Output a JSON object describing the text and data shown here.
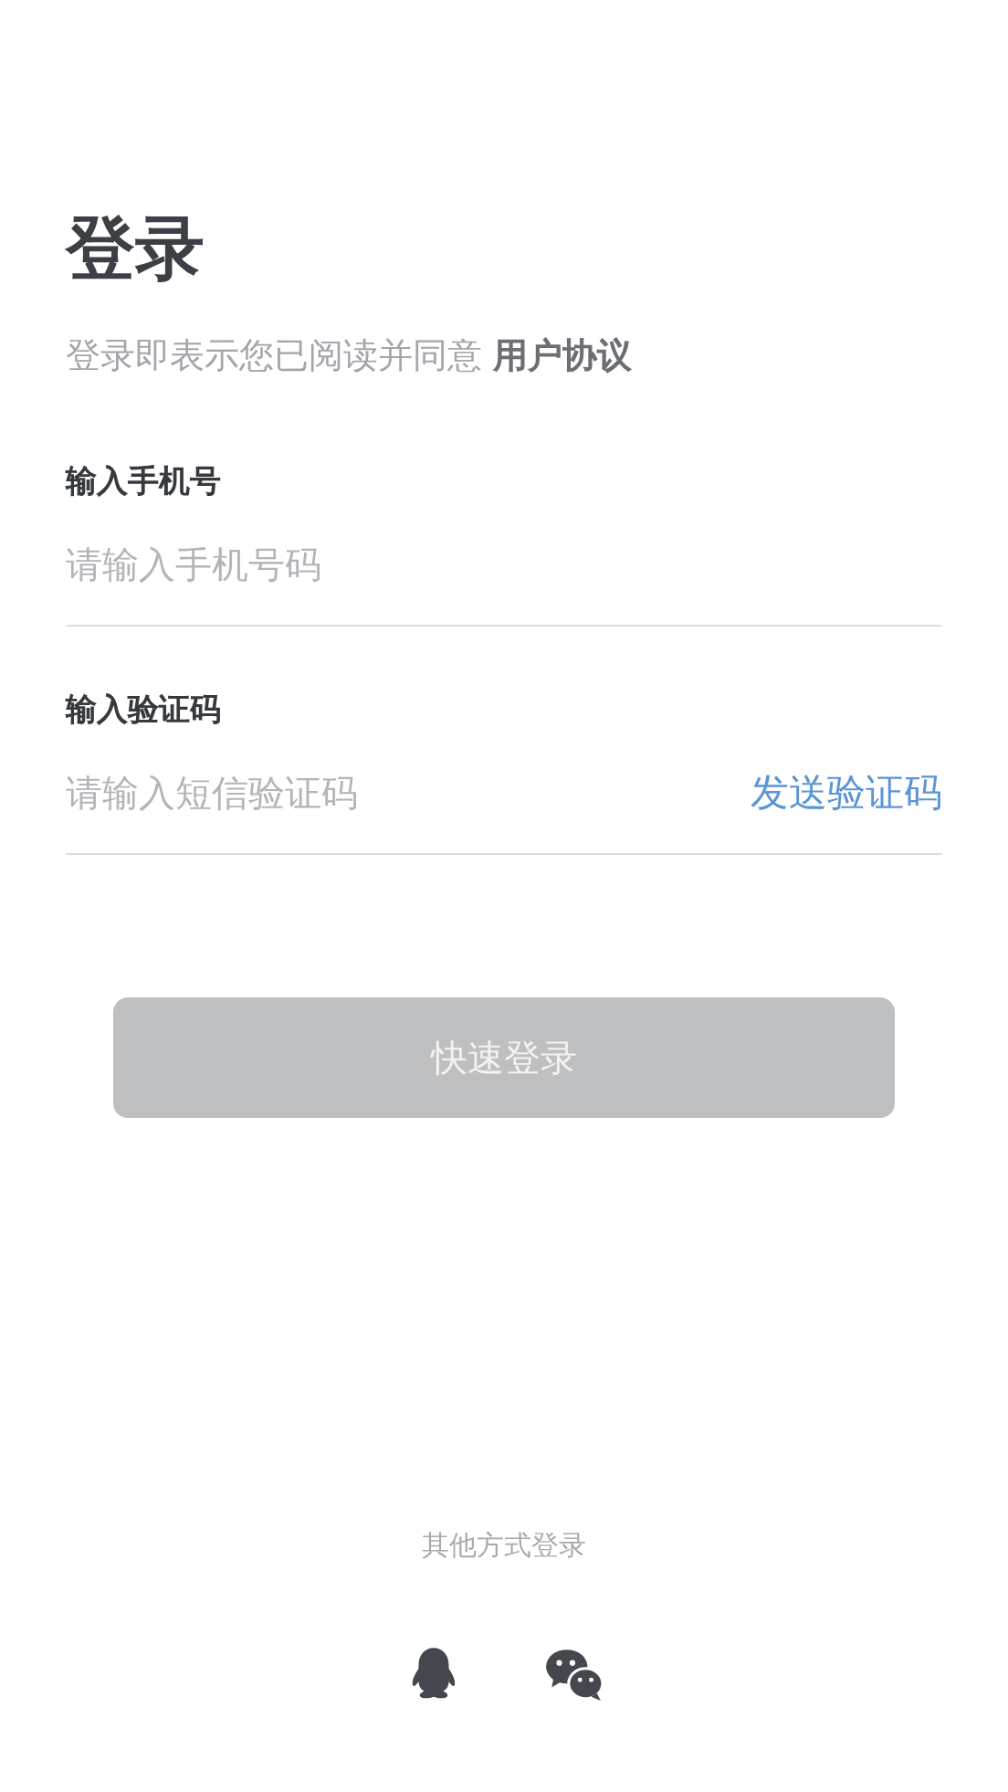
{
  "title": "登录",
  "agreement": {
    "text": "登录即表示您已阅读并同意 ",
    "link": "用户协议"
  },
  "fields": [
    {
      "label": "输入手机号",
      "placeholder": "请输入手机号码"
    },
    {
      "label": "输入验证码",
      "placeholder": "请输入短信验证码",
      "action": "发送验证码"
    }
  ],
  "login_button": {
    "label": "快速登录",
    "disabled": true
  },
  "other_login": {
    "label": "其他方式登录",
    "methods": [
      {
        "kind": "qq"
      },
      {
        "kind": "wechat"
      }
    ]
  }
}
